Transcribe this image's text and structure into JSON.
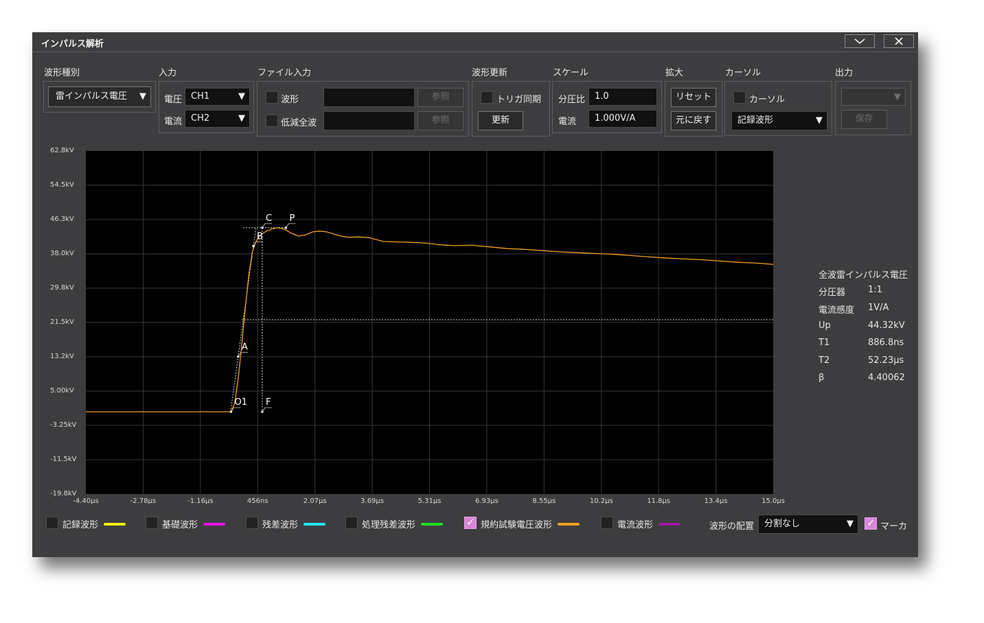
{
  "window": {
    "title": "インパルス解析",
    "minimize_glyph": "⌄",
    "close_glyph": "✕"
  },
  "groups": {
    "waveform_type": {
      "label": "波形種別",
      "value": "雷インパルス電圧"
    },
    "input": {
      "label": "入力",
      "voltage_label": "電圧",
      "voltage_value": "CH1",
      "current_label": "電流",
      "current_value": "CH2"
    },
    "file_input": {
      "label": "ファイル入力",
      "waveform_label": "波形",
      "reduced_label": "低減全波",
      "browse_label": "参照"
    },
    "update": {
      "label": "波形更新",
      "trigger_sync_label": "トリガ同期",
      "update_button": "更新"
    },
    "scale": {
      "label": "スケール",
      "ratio_label": "分圧比",
      "ratio_value": "1.0",
      "current_label": "電流",
      "current_value": "1.000V/A"
    },
    "zoom": {
      "label": "拡大",
      "reset_button": "リセット",
      "restore_button": "元に戻す"
    },
    "cursor": {
      "label": "カーソル",
      "cursor_check_label": "カーソル",
      "cursor_target": "記録波形"
    },
    "output": {
      "label": "出力",
      "save_button": "保存"
    }
  },
  "chart_data": {
    "type": "line",
    "y_ticks": [
      "62.8kV",
      "54.5kV",
      "46.3kV",
      "38.0kV",
      "29.8kV",
      "21.5kV",
      "13.2kV",
      "5.00kV",
      "-3.25kV",
      "-11.5kV",
      "-19.8kV"
    ],
    "x_ticks": [
      "-4.40µs",
      "-2.78µs",
      "-1.16µs",
      "456ns",
      "2.07µs",
      "3.69µs",
      "5.31µs",
      "6.93µs",
      "8.55µs",
      "10.2µs",
      "11.8µs",
      "13.4µs",
      "15.0µs"
    ],
    "ylim": [
      -19.8,
      62.8
    ],
    "xlim": [
      -4.4,
      15.0
    ],
    "series": [
      {
        "color": "#f0a020",
        "x": [
          -4.4,
          -0.3,
          -0.2,
          -0.1,
          0.0,
          0.1,
          0.2,
          0.3,
          0.4,
          0.5,
          0.6,
          0.7,
          0.85,
          1.0,
          1.2,
          1.4,
          1.6,
          1.8,
          2.0,
          2.2,
          2.4,
          2.6,
          2.8,
          3.0,
          3.3,
          3.6,
          4.0,
          4.4,
          4.8,
          5.2,
          5.6,
          6.0,
          6.5,
          7.0,
          7.5,
          8.0,
          8.5,
          9.0,
          9.5,
          10.0,
          10.5,
          11.0,
          11.5,
          12.0,
          12.5,
          13.0,
          13.5,
          14.0,
          14.5,
          15.0
        ],
        "y": [
          0,
          0,
          2.0,
          8.0,
          16.0,
          25.0,
          33.0,
          38.5,
          41.0,
          42.3,
          43.0,
          43.5,
          44.0,
          44.32,
          44.0,
          43.0,
          42.3,
          42.6,
          43.3,
          43.5,
          43.3,
          42.8,
          42.3,
          42.0,
          42.1,
          41.9,
          41.0,
          40.9,
          40.8,
          40.6,
          40.2,
          40.0,
          40.1,
          39.7,
          39.3,
          39.1,
          38.8,
          38.5,
          38.3,
          38.1,
          37.9,
          37.6,
          37.3,
          37.0,
          36.8,
          36.6,
          36.3,
          36.0,
          35.8,
          35.5
        ]
      }
    ],
    "markers": [
      {
        "label": "O1",
        "x": -0.3,
        "y": 0
      },
      {
        "label": "A",
        "x": -0.1,
        "y": 13.3
      },
      {
        "label": "B",
        "x": 0.33,
        "y": 39.9
      },
      {
        "label": "C",
        "x": 0.58,
        "y": 44.32
      },
      {
        "label": "P",
        "x": 1.25,
        "y": 44.32
      },
      {
        "label": "F",
        "x": 0.58,
        "y": 0
      }
    ],
    "half_value_level": 22.16
  },
  "info": {
    "heading": "全波雷インパルス電圧",
    "rows": [
      {
        "key": "分圧器",
        "value": "1:1"
      },
      {
        "key": "電流感度",
        "value": "1V/A"
      },
      {
        "key": "Up",
        "value": "44.32kV"
      },
      {
        "key": "T1",
        "value": "886.8ns"
      },
      {
        "key": "T2",
        "value": "52.23µs"
      },
      {
        "key": "β",
        "value": "4.40062"
      }
    ]
  },
  "legend": {
    "items": [
      {
        "label": "記録波形",
        "color": "#f0f000",
        "checked": false
      },
      {
        "label": "基礎波形",
        "color": "#ee10ee",
        "checked": false
      },
      {
        "label": "残差波形",
        "color": "#20e8f0",
        "checked": false
      },
      {
        "label": "処理残差波形",
        "color": "#20e020",
        "checked": false
      },
      {
        "label": "規約試験電圧波形",
        "color": "#f0a020",
        "checked": true
      },
      {
        "label": "電流波形",
        "color": "#9a1aa0",
        "checked": false
      }
    ],
    "layout_label": "波形の配置",
    "layout_value": "分割なし",
    "marker_label": "マーカ",
    "marker_checked": true
  },
  "colors": {
    "plot_bg": "#000000",
    "grid": "#3a3a3a",
    "window_bg": "#3d3d3f"
  }
}
